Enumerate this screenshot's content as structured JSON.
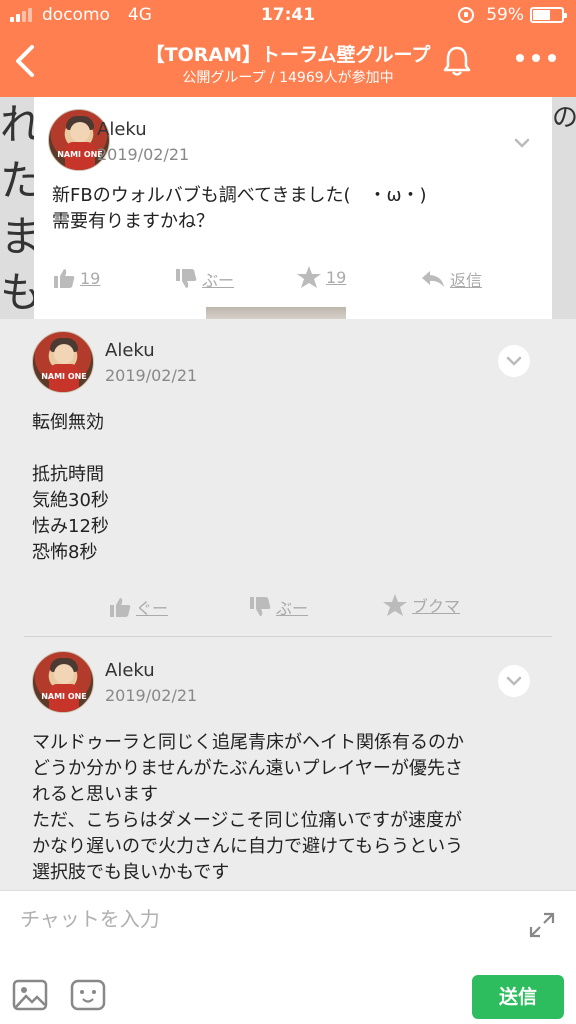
{
  "status_bar": {
    "carrier": "docomo",
    "network": "4G",
    "time": "17:41",
    "battery_percent": "59%",
    "battery_level": 0.59
  },
  "header": {
    "title": "【TORAM】トーラム壁グループ",
    "subtitle": "公開グループ / 14969人が参加中",
    "accent_color": "#ff7f50"
  },
  "pinned_post": {
    "author": "Aleku",
    "date": "2019/02/21",
    "text": "新FBのウォルバブも調べてきました(　・ω・)\n需要有りますかね？",
    "like_count": "19",
    "dislike_label": "ぶー",
    "star_count": "19",
    "reply_label": "返信",
    "side_deco_left": "れたまもる",
    "side_deco_right": "の"
  },
  "posts": [
    {
      "author": "Aleku",
      "date": "2019/02/21",
      "text": "転倒無効\n\n抵抗時間\n気絶30秒\n怯み12秒\n恐怖8秒",
      "good_label": "ぐー",
      "bad_label": "ぶー",
      "bookmark_label": "ブクマ"
    },
    {
      "author": "Aleku",
      "date": "2019/02/21",
      "text": "マルドゥーラと同じく追尾青床がヘイト関係有るのか\nどうか分かりませんがたぶん遠いプレイヤーが優先さ\nれると思います\nただ、こちらはダメージこそ同じ位痛いですが速度が\nかなり遅いので火力さんに自力で避けてもらうという\n選択肢でも良いかもです"
    }
  ],
  "avatar_tag": "NAMI ONE",
  "input_bar": {
    "placeholder": "チャットを入力",
    "send_label": "送信",
    "send_color": "#2dbd5e"
  }
}
